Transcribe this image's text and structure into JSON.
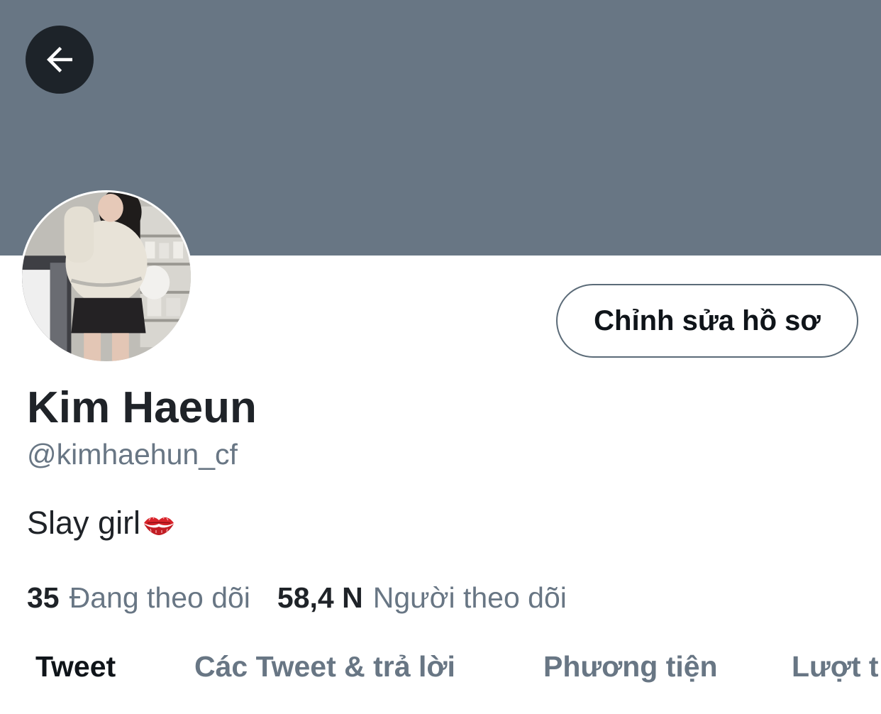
{
  "header": {
    "back_icon": "arrow-left-icon",
    "banner_color": "#687684"
  },
  "profile": {
    "edit_button_label": "Chỉnh sửa hồ sơ",
    "display_name": "Kim Haeun",
    "handle": "@kimhaehun_cf",
    "bio": "Slay girl",
    "bio_emoji": "lips-icon"
  },
  "stats": {
    "following_count": "35",
    "following_label": "Đang theo dõi",
    "followers_count": "58,4 N",
    "followers_label": "Người theo dõi"
  },
  "tabs": [
    {
      "label": "Tweet",
      "active": true
    },
    {
      "label": "Các Tweet & trả lời",
      "active": false
    },
    {
      "label": "Phương tiện",
      "active": false
    },
    {
      "label": "Lượt t",
      "active": false
    }
  ],
  "colors": {
    "primary_text": "#0f1419",
    "secondary_text": "#687684"
  }
}
